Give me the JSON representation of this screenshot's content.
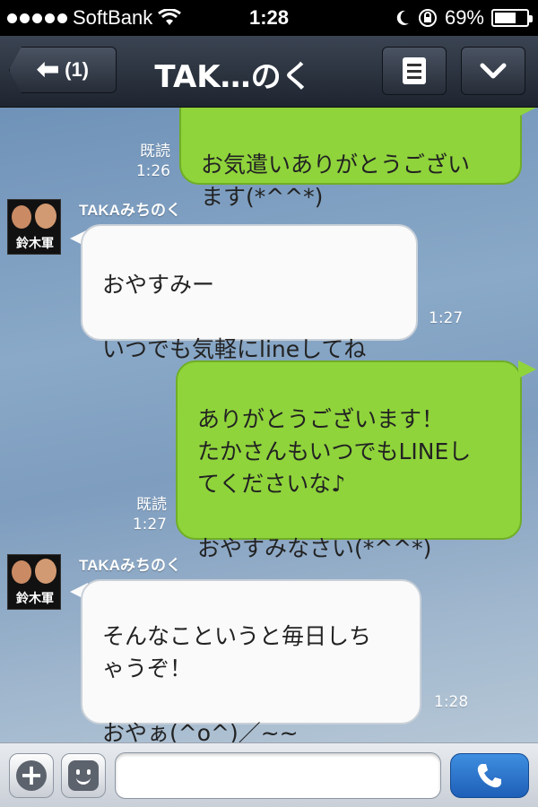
{
  "status_bar": {
    "carrier": "SoftBank",
    "time": "1:28",
    "battery": "69%",
    "battery_level": 0.69
  },
  "header": {
    "back_label": "(1)",
    "title": "TAK…のく"
  },
  "messages": [
    {
      "direction": "out",
      "text": "お気遣いありがとうござい\nます(*^^*)",
      "read_label": "既読",
      "time": "1:26"
    },
    {
      "direction": "in",
      "sender": "TAKAみちのく",
      "text": "おやすみー\n\nいつでも気軽にlineしてね",
      "time": "1:27"
    },
    {
      "direction": "out",
      "text": "ありがとうございます！\nたかさんもいつでもLINEし\nてくださいな♪\n\nおやすみなさい(*^^*)",
      "read_label": "既読",
      "time": "1:27"
    },
    {
      "direction": "in",
      "sender": "TAKAみちのく",
      "text": "そんなこというと毎日しち\nゃうぞ！\n\nおやぁ(^o^)／~~",
      "time": "1:28"
    }
  ],
  "avatar_glyph": "鈴木軍",
  "input": {
    "placeholder": "",
    "value": ""
  },
  "colors": {
    "outgoing_bubble": "#8fd43b",
    "incoming_bubble": "#fafafa",
    "call_button": "#2f7fd6"
  }
}
